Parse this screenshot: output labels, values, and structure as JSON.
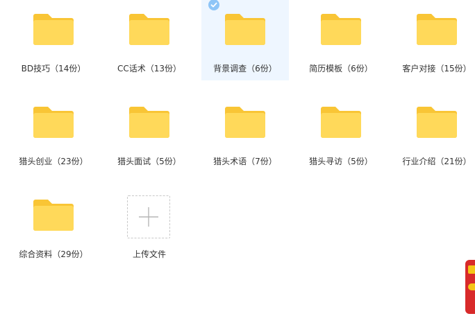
{
  "colors": {
    "folder_back": "#f9c535",
    "folder_front": "#ffd95a",
    "selected_bg": "#eef6ff",
    "check_badge": "#8ec5f7",
    "label_text": "#333333"
  },
  "folders": [
    {
      "label": "BD技巧（14份）",
      "icon": "folder-icon",
      "selected": false
    },
    {
      "label": "CC话术（13份）",
      "icon": "folder-icon",
      "selected": false
    },
    {
      "label": "背景调查（6份）",
      "icon": "folder-icon",
      "selected": true
    },
    {
      "label": "简历模板（6份）",
      "icon": "folder-icon",
      "selected": false
    },
    {
      "label": "客户对接（15份）",
      "icon": "folder-icon",
      "selected": false
    },
    {
      "label": "猎头创业（23份）",
      "icon": "folder-icon",
      "selected": false
    },
    {
      "label": "猎头面试（5份）",
      "icon": "folder-icon",
      "selected": false
    },
    {
      "label": "猎头术语（7份）",
      "icon": "folder-icon",
      "selected": false
    },
    {
      "label": "猎头寻访（5份）",
      "icon": "folder-icon",
      "selected": false
    },
    {
      "label": "行业介绍（21份）",
      "icon": "folder-icon",
      "selected": false
    },
    {
      "label": "综合资料（29份）",
      "icon": "folder-icon",
      "selected": false
    }
  ],
  "upload": {
    "label": "上传文件",
    "icon": "plus-icon"
  },
  "side_widget": {
    "icon": "floating-promo-icon"
  }
}
